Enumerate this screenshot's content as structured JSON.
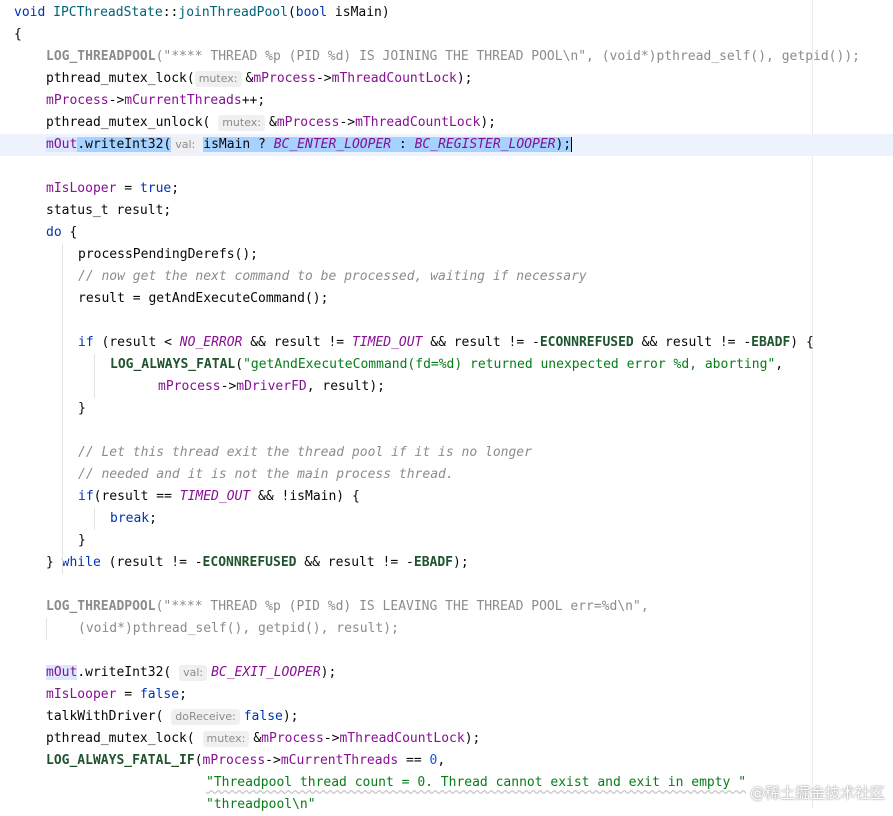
{
  "editor": {
    "lines": [
      {
        "indent": 0,
        "segs": [
          {
            "t": "void ",
            "c": "kw"
          },
          {
            "t": "IPCThreadState",
            "c": "fn"
          },
          {
            "t": "::"
          },
          {
            "t": "joinThreadPool",
            "c": "fn"
          },
          {
            "t": "("
          },
          {
            "t": "bool ",
            "c": "kw"
          },
          {
            "t": "isMain)"
          }
        ]
      },
      {
        "indent": 0,
        "segs": [
          {
            "t": "{"
          }
        ]
      },
      {
        "indent": 1,
        "segs": [
          {
            "t": "LOG_THREADPOOL",
            "c": "macro-dim"
          },
          {
            "t": "(\"**** THREAD %p (PID %d) IS JOINING THE THREAD POOL\\n\", (void*)pthread_self(), getpid());",
            "c": "str-dim"
          }
        ]
      },
      {
        "indent": 1,
        "segs": [
          {
            "t": "pthread_mutex_lock("
          },
          {
            "hint": "mutex:"
          },
          {
            "t": "&"
          },
          {
            "t": "mProcess",
            "c": "fld"
          },
          {
            "t": "->"
          },
          {
            "t": "mThreadCountLock",
            "c": "fld"
          },
          {
            "t": ");"
          }
        ]
      },
      {
        "indent": 1,
        "segs": [
          {
            "t": "mProcess",
            "c": "fld"
          },
          {
            "t": "->"
          },
          {
            "t": "mCurrentThreads",
            "c": "fld"
          },
          {
            "t": "++;"
          }
        ]
      },
      {
        "indent": 1,
        "segs": [
          {
            "t": "pthread_mutex_unlock( "
          },
          {
            "hint": "mutex:"
          },
          {
            "t": "&"
          },
          {
            "t": "mProcess",
            "c": "fld"
          },
          {
            "t": "->"
          },
          {
            "t": "mThreadCountLock",
            "c": "fld"
          },
          {
            "t": ");"
          }
        ]
      },
      {
        "indent": 1,
        "hl": true,
        "segs": [
          {
            "t": "mOut",
            "c": "fld ref"
          },
          {
            "t": ".writeInt32(",
            "c": "sel"
          },
          {
            "hint": "val:"
          },
          {
            "t": "isMain ? ",
            "c": "sel"
          },
          {
            "t": "BC_ENTER_LOOPER",
            "c": "enumc sel"
          },
          {
            "t": " : ",
            "c": "sel"
          },
          {
            "t": "BC_REGISTER_LOOPER",
            "c": "enumc sel"
          },
          {
            "t": ");",
            "c": "sel"
          },
          {
            "caret": true
          }
        ]
      },
      {
        "indent": 0,
        "segs": []
      },
      {
        "indent": 1,
        "segs": [
          {
            "t": "mIsLooper",
            "c": "fld"
          },
          {
            "t": " = "
          },
          {
            "t": "true",
            "c": "kw"
          },
          {
            "t": ";"
          }
        ]
      },
      {
        "indent": 1,
        "segs": [
          {
            "t": "status_t result;"
          }
        ]
      },
      {
        "indent": 1,
        "segs": [
          {
            "t": "do ",
            "c": "kw"
          },
          {
            "t": "{"
          }
        ]
      },
      {
        "indent": 2,
        "segs": [
          {
            "t": "processPendingDerefs();"
          }
        ]
      },
      {
        "indent": 2,
        "segs": [
          {
            "t": "// now get the next command to be processed, waiting if necessary",
            "c": "cmt"
          }
        ]
      },
      {
        "indent": 2,
        "segs": [
          {
            "t": "result = getAndExecuteCommand();"
          }
        ]
      },
      {
        "indent": 0,
        "segs": []
      },
      {
        "indent": 2,
        "segs": [
          {
            "t": "if ",
            "c": "kw"
          },
          {
            "t": "(result < "
          },
          {
            "t": "NO_ERROR",
            "c": "enumc"
          },
          {
            "t": " && result != "
          },
          {
            "t": "TIMED_OUT",
            "c": "enumc"
          },
          {
            "t": " && result != -"
          },
          {
            "t": "ECONNREFUSED",
            "c": "macro"
          },
          {
            "t": " && result != -"
          },
          {
            "t": "EBADF",
            "c": "macro"
          },
          {
            "t": ") {"
          }
        ]
      },
      {
        "indent": 3,
        "segs": [
          {
            "t": "LOG_ALWAYS_FATAL",
            "c": "macro"
          },
          {
            "t": "("
          },
          {
            "t": "\"getAndExecuteCommand(fd=%d) returned unexpected error %d, aborting\"",
            "c": "str"
          },
          {
            "t": ","
          }
        ]
      },
      {
        "indent": 4.5,
        "segs": [
          {
            "t": "mProcess",
            "c": "fld"
          },
          {
            "t": "->"
          },
          {
            "t": "mDriverFD",
            "c": "fld"
          },
          {
            "t": ", result);"
          }
        ]
      },
      {
        "indent": 2,
        "segs": [
          {
            "t": "}"
          }
        ]
      },
      {
        "indent": 0,
        "segs": []
      },
      {
        "indent": 2,
        "segs": [
          {
            "t": "// Let this thread exit the thread pool if it is no longer",
            "c": "cmt"
          }
        ]
      },
      {
        "indent": 2,
        "segs": [
          {
            "t": "// needed and it is not the main process thread.",
            "c": "cmt"
          }
        ]
      },
      {
        "indent": 2,
        "segs": [
          {
            "t": "if",
            "c": "kw"
          },
          {
            "t": "(result == "
          },
          {
            "t": "TIMED_OUT",
            "c": "enumc"
          },
          {
            "t": " && !isMain) {"
          }
        ]
      },
      {
        "indent": 3,
        "segs": [
          {
            "t": "break",
            "c": "kw"
          },
          {
            "t": ";"
          }
        ]
      },
      {
        "indent": 2,
        "segs": [
          {
            "t": "}"
          }
        ]
      },
      {
        "indent": 1,
        "segs": [
          {
            "t": "} "
          },
          {
            "t": "while ",
            "c": "kw"
          },
          {
            "t": "(result != -"
          },
          {
            "t": "ECONNREFUSED",
            "c": "macro"
          },
          {
            "t": " && result != -"
          },
          {
            "t": "EBADF",
            "c": "macro"
          },
          {
            "t": ");"
          }
        ]
      },
      {
        "indent": 0,
        "segs": []
      },
      {
        "indent": 1,
        "segs": [
          {
            "t": "LOG_THREADPOOL",
            "c": "macro-dim"
          },
          {
            "t": "(\"**** THREAD %p (PID %d) IS LEAVING THE THREAD POOL err=%d\\n\",",
            "c": "str-dim"
          }
        ]
      },
      {
        "indent": 2,
        "segs": [
          {
            "t": "(void*)pthread_self(), getpid(), result);",
            "c": "str-dim"
          }
        ]
      },
      {
        "indent": 0,
        "segs": []
      },
      {
        "indent": 1,
        "segs": [
          {
            "t": "mOut",
            "c": "fld ref"
          },
          {
            "t": ".writeInt32( "
          },
          {
            "hint": "val:"
          },
          {
            "t": "BC_EXIT_LOOPER",
            "c": "enumc"
          },
          {
            "t": ");"
          }
        ]
      },
      {
        "indent": 1,
        "segs": [
          {
            "t": "mIsLooper",
            "c": "fld"
          },
          {
            "t": " = "
          },
          {
            "t": "false",
            "c": "kw"
          },
          {
            "t": ";"
          }
        ]
      },
      {
        "indent": 1,
        "segs": [
          {
            "t": "talkWithDriver( "
          },
          {
            "hint": "doReceive:"
          },
          {
            "t": "false",
            "c": "kw"
          },
          {
            "t": ");"
          }
        ]
      },
      {
        "indent": 1,
        "segs": [
          {
            "t": "pthread_mutex_lock( "
          },
          {
            "hint": "mutex:"
          },
          {
            "t": "&"
          },
          {
            "t": "mProcess",
            "c": "fld"
          },
          {
            "t": "->"
          },
          {
            "t": "mThreadCountLock",
            "c": "fld"
          },
          {
            "t": ");"
          }
        ]
      },
      {
        "indent": 1,
        "segs": [
          {
            "t": "LOG_ALWAYS_FATAL_IF",
            "c": "macro"
          },
          {
            "t": "("
          },
          {
            "t": "mProcess",
            "c": "fld"
          },
          {
            "t": "->"
          },
          {
            "t": "mCurrentThreads",
            "c": "fld"
          },
          {
            "t": " == "
          },
          {
            "t": "0",
            "c": "num"
          },
          {
            "t": ","
          }
        ]
      },
      {
        "indent": 6,
        "segs": [
          {
            "t": "\"Threadpool thread count = 0. Thread cannot exist and exit in empty \"",
            "c": "str squig"
          }
        ]
      },
      {
        "indent": 6,
        "segs": [
          {
            "t": "\"threadpool\\n\"",
            "c": "str"
          }
        ]
      }
    ]
  },
  "watermark": "@稀土掘金技术社区"
}
